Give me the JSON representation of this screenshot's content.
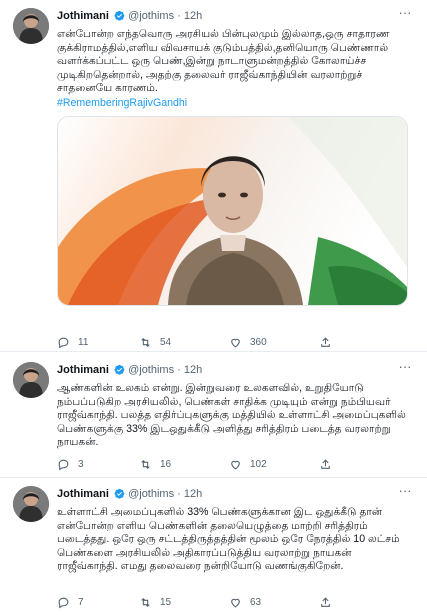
{
  "colors": {
    "link": "#1d9bf0",
    "secondary_text": "#536471",
    "verified_badge": "#1d9bf0",
    "divider": "#e6ecf0"
  },
  "tweets": [
    {
      "author": {
        "name": "Jothimani",
        "handle": "@jothims",
        "verified": true,
        "avatar_icon": "profile-photo"
      },
      "separator": "·",
      "time": "12h",
      "text": "என்போன்ற எந்தவொரு அரசியல் பின்புலமும் இல்லாத,ஒரு சாதாரண குக்கிராமத்தில்,எளிய விவசாயக் குடும்பத்தில்,தனியொரு பெண்ணால் வளர்க்கப்பட்ட ஒரு பெண்,இன்று நாடாளுமன்றத்தில் கோலாய்ச்ச முடிகிறதென்றால், அதற்கு தலைவர் ராஜீவ்காந்தியின் வரலாற்றுச் சாதனையே காரணம்.",
      "hashtag": "#RememberingRajivGandhi",
      "has_media": true,
      "media_icon": "portrait-photo-tricolor-background",
      "actions": {
        "replies": "11",
        "retweets": "54",
        "likes": "360"
      }
    },
    {
      "author": {
        "name": "Jothimani",
        "handle": "@jothims",
        "verified": true,
        "avatar_icon": "profile-photo"
      },
      "separator": "·",
      "time": "12h",
      "text": "ஆண்களின் உலகம் என்று. இன்றுவரை உலகளவில், உறுதியோடு நம்பப்படுகிற அரசியலில், பெண்கள் சாதிக்க முடியும் என்று நம்பியவர் ராஜீவ்காந்தி. பலத்த எதிர்ப்புகளுக்கு மத்தியில் உள்ளாட்சி அமைப்புகளில் பெண்களுக்கு 33% இடஒதுக்கீடு அளித்து சரித்திரம் படைத்த வரலாற்று நாயகன்.",
      "actions": {
        "replies": "3",
        "retweets": "16",
        "likes": "102"
      }
    },
    {
      "author": {
        "name": "Jothimani",
        "handle": "@jothims",
        "verified": true,
        "avatar_icon": "profile-photo"
      },
      "separator": "·",
      "time": "12h",
      "text": "உள்ளாட்சி அமைப்புகளில் 33% பெண்களுக்கான இட ஒதுக்கீடு தான் என்போன்ற எளிய பெண்களின் தலையெழுத்தை மாற்றி சரித்திரம் படைத்தது. ஒரே ஒரு சட்டத்திருத்தத்தின் மூலம் ஒரே நேரத்தில் 10 லட்சம் பெண்களை அரசியலில் அதிகாரப்படுத்திய வரலாற்று நாயகன் ராஜீவ்காந்தி. எமது தலைவரை நன்றியோடு வணங்குகிறேன்.",
      "actions": {
        "replies": "7",
        "retweets": "15",
        "likes": "63"
      }
    }
  ]
}
